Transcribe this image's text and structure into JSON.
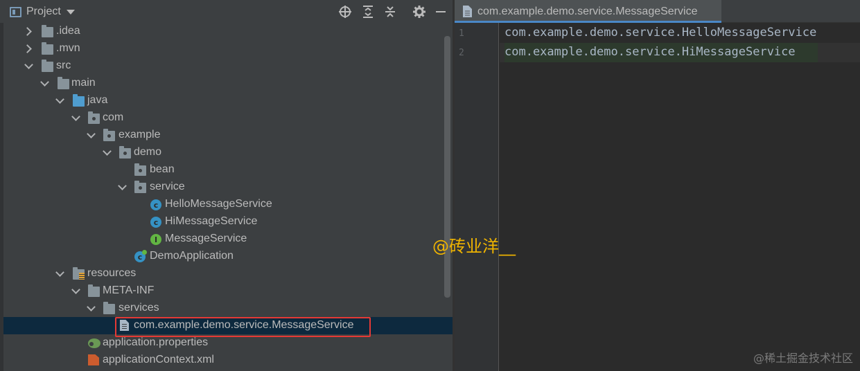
{
  "project_panel": {
    "title": "Project",
    "tree": [
      {
        "label": ".idea",
        "icon": "folder-icon"
      },
      {
        "label": ".mvn",
        "icon": "folder-icon"
      },
      {
        "label": "src",
        "icon": "folder-icon"
      },
      {
        "label": "main",
        "icon": "folder-icon"
      },
      {
        "label": "java",
        "icon": "source-folder-icon"
      },
      {
        "label": "com",
        "icon": "package-icon"
      },
      {
        "label": "example",
        "icon": "package-icon"
      },
      {
        "label": "demo",
        "icon": "package-icon"
      },
      {
        "label": "bean",
        "icon": "package-icon"
      },
      {
        "label": "service",
        "icon": "package-icon"
      },
      {
        "label": "HelloMessageService",
        "icon": "class-icon"
      },
      {
        "label": "HiMessageService",
        "icon": "class-icon"
      },
      {
        "label": "MessageService",
        "icon": "interface-icon"
      },
      {
        "label": "DemoApplication",
        "icon": "spring-boot-class-icon"
      },
      {
        "label": "resources",
        "icon": "resources-folder-icon"
      },
      {
        "label": "META-INF",
        "icon": "folder-icon"
      },
      {
        "label": "services",
        "icon": "folder-icon"
      },
      {
        "label": "com.example.demo.service.MessageService",
        "icon": "text-file-icon"
      },
      {
        "label": "application.properties",
        "icon": "properties-file-icon"
      },
      {
        "label": "applicationContext.xml",
        "icon": "xml-file-icon"
      }
    ],
    "selected_index": 17
  },
  "editor": {
    "tab_label": "com.example.demo.service.MessageService",
    "lines": [
      {
        "number": "1",
        "text": "com.example.demo.service.HelloMessageService"
      },
      {
        "number": "2",
        "text": "com.example.demo.service.HiMessageService"
      }
    ]
  },
  "watermark": "@砖业洋__",
  "corner_watermark": "@稀土掘金技术社区",
  "colors": {
    "panel_bg": "#3c3f41",
    "editor_bg": "#2b2b2b",
    "selection_bg": "#0d293e",
    "highlight_box": "#e53935",
    "watermark": "#f0b400",
    "tab_underline": "#4a88c7"
  }
}
